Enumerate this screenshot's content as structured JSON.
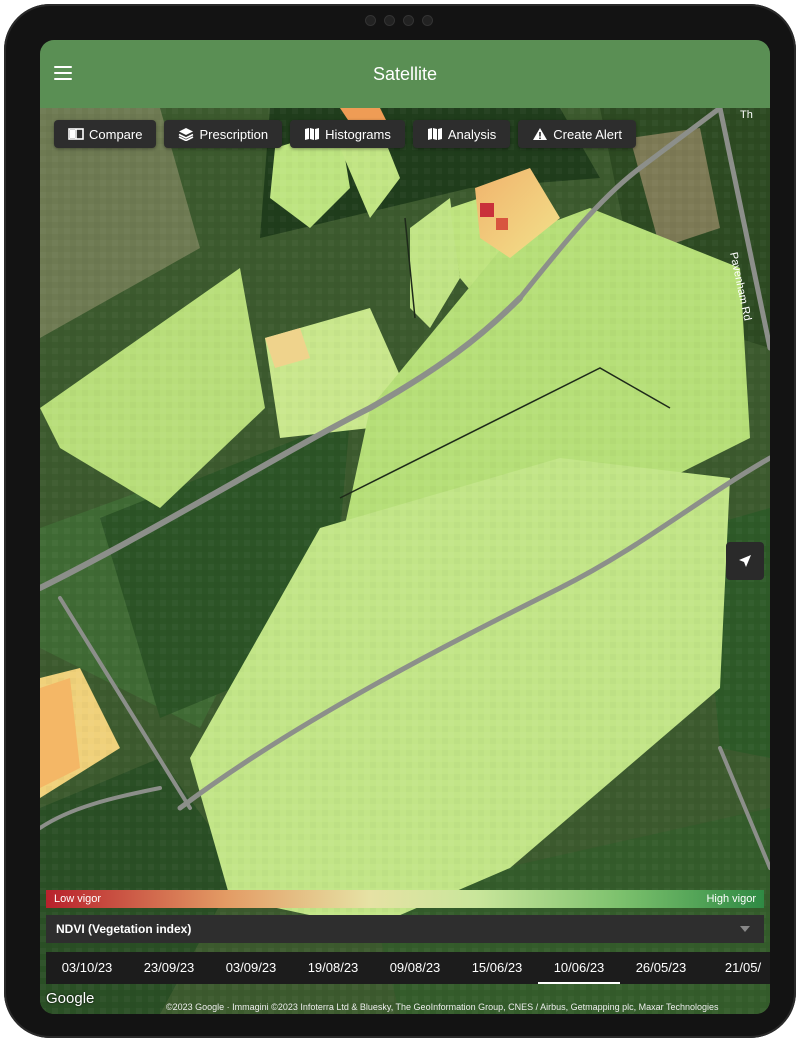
{
  "header": {
    "title": "Satellite"
  },
  "toolbar": [
    {
      "label": "Compare",
      "icon": "compare-icon"
    },
    {
      "label": "Prescription",
      "icon": "layers-icon"
    },
    {
      "label": "Histograms",
      "icon": "map-icon"
    },
    {
      "label": "Analysis",
      "icon": "map-icon"
    },
    {
      "label": "Create Alert",
      "icon": "warning-icon"
    }
  ],
  "map": {
    "road_label": "Pavenham Rd",
    "road_label_partial": "Th"
  },
  "legend": {
    "low": "Low vigor",
    "high": "High vigor"
  },
  "index_select": {
    "value": "NDVI (Vegetation index)"
  },
  "dates": [
    "03/10/23",
    "23/09/23",
    "03/09/23",
    "19/08/23",
    "09/08/23",
    "15/06/23",
    "10/06/23",
    "26/05/23",
    "21/05/"
  ],
  "active_date": "10/06/23",
  "footer": {
    "google": "Google",
    "attribution": "©2023 Google · Immagini ©2023 Infoterra Ltd & Bluesky, The GeoInformation Group, CNES / Airbus, Getmapping plc, Maxar Technologies"
  },
  "colors": {
    "header": "#5a8f54",
    "high": "#2f8a44",
    "low": "#b8212c"
  }
}
